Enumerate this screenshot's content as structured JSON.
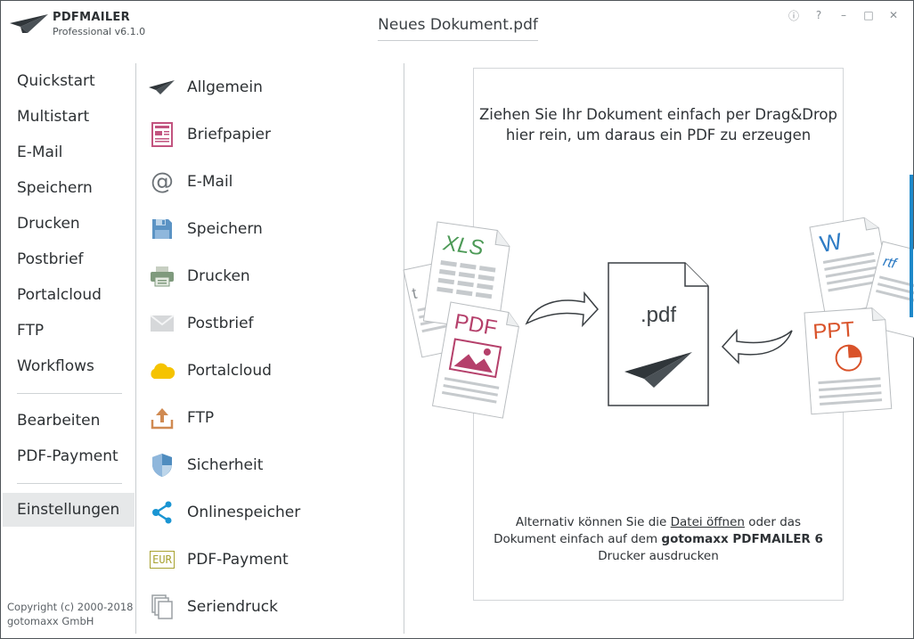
{
  "app": {
    "name": "PDFMAILER",
    "edition": "Professional v6.1.0",
    "document_title": "Neues Dokument.pdf"
  },
  "window_controls": {
    "info": "ⓘ",
    "help": "?",
    "minimize": "–",
    "maximize": "□",
    "close": "✕"
  },
  "leftnav": {
    "group1": [
      "Quickstart",
      "Multistart",
      "E-Mail",
      "Speichern",
      "Drucken",
      "Postbrief",
      "Portalcloud",
      "FTP",
      "Workflows"
    ],
    "group2": [
      "Bearbeiten",
      "PDF-Payment"
    ],
    "group3": [
      "Einstellungen"
    ],
    "active": "Einstellungen"
  },
  "copyright": {
    "line1": "Copyright (c) 2000-2018",
    "line2": "gotomaxx GmbH"
  },
  "settings": [
    {
      "label": "Allgemein",
      "icon": "paper-plane-icon"
    },
    {
      "label": "Briefpapier",
      "icon": "letterhead-icon"
    },
    {
      "label": "E-Mail",
      "icon": "at-sign-icon"
    },
    {
      "label": "Speichern",
      "icon": "floppy-disk-icon"
    },
    {
      "label": "Drucken",
      "icon": "printer-icon"
    },
    {
      "label": "Postbrief",
      "icon": "envelope-icon"
    },
    {
      "label": "Portalcloud",
      "icon": "cloud-icon"
    },
    {
      "label": "FTP",
      "icon": "upload-icon"
    },
    {
      "label": "Sicherheit",
      "icon": "shield-icon"
    },
    {
      "label": "Onlinespeicher",
      "icon": "share-icon"
    },
    {
      "label": "PDF-Payment",
      "icon": "eur-icon"
    },
    {
      "label": "Seriendruck",
      "icon": "documents-stack-icon"
    }
  ],
  "dropzone": {
    "headline_line1": "Ziehen Sie Ihr Dokument einfach per Drag&Drop",
    "headline_line2": "hier rein, um daraus ein PDF zu erzeugen",
    "footer_part1": "Alternativ können Sie die ",
    "footer_link": "Datei öffnen",
    "footer_part2": " oder das",
    "footer_line2_part1": "Dokument einfach auf dem ",
    "footer_line2_bold": "gotomaxx PDFMAILER 6",
    "footer_line3": "Drucker ausdrucken"
  },
  "illustration": {
    "xls": "XLS",
    "pdf": "PDF",
    "center": ".pdf",
    "word": "W",
    "rtf": "rtf",
    "ppt": "PPT",
    "txt": "t"
  },
  "colors": {
    "xls": "#4d9a57",
    "pdf": "#b5406b",
    "ppt": "#d9532a",
    "word": "#2d7bc4",
    "cloud": "#f5c300",
    "share": "#1a95d3",
    "floppy": "#4f8cbf",
    "upload": "#d08a52",
    "eur": "#a7a12f"
  }
}
